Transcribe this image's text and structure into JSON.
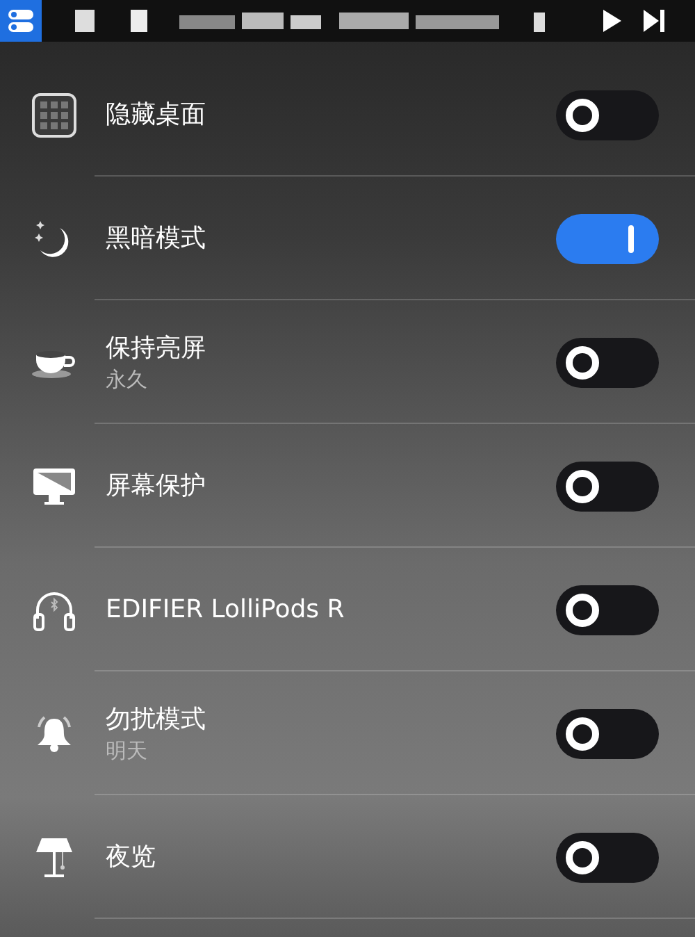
{
  "menu_bar": {
    "toggle_selected": true
  },
  "items": [
    {
      "kind": "grid",
      "label": "隐藏桌面",
      "on": false
    },
    {
      "kind": "moon",
      "label": "黑暗模式",
      "on": true
    },
    {
      "kind": "cup",
      "label": "保持亮屏",
      "sublabel": "永久",
      "on": false
    },
    {
      "kind": "monitor",
      "label": "屏幕保护",
      "on": false
    },
    {
      "kind": "headphones",
      "label": "EDIFIER LolliPods R",
      "on": false
    },
    {
      "kind": "bell",
      "label": "勿扰模式",
      "sublabel": "明天",
      "on": false
    },
    {
      "kind": "lamp",
      "label": "夜览",
      "on": false
    }
  ]
}
